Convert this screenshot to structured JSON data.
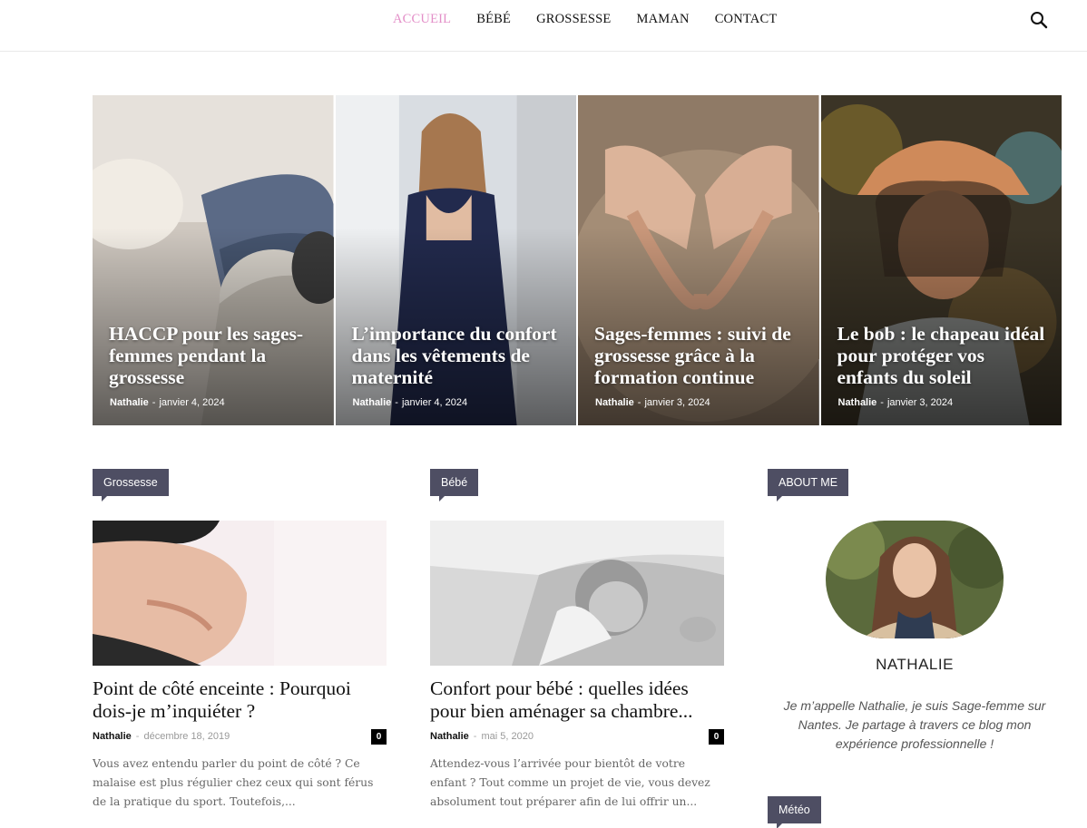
{
  "nav": {
    "items": [
      {
        "label": "ACCUEIL",
        "active": true
      },
      {
        "label": "BÉBÉ",
        "active": false
      },
      {
        "label": "GROSSESSE",
        "active": false
      },
      {
        "label": "MAMAN",
        "active": false
      },
      {
        "label": "CONTACT",
        "active": false
      }
    ],
    "search_icon": "search-icon",
    "active_color": "#e38fc8"
  },
  "featured": [
    {
      "title": "HACCP pour les sages-femmes pendant la grossesse",
      "author": "Nathalie",
      "date": "janvier 4, 2024"
    },
    {
      "title": "L’importance du confort dans les vêtements de maternité",
      "author": "Nathalie",
      "date": "janvier 4, 2024"
    },
    {
      "title": "Sages-femmes : suivi de grossesse grâce à la formation continue",
      "author": "Nathalie",
      "date": "janvier 3, 2024"
    },
    {
      "title": "Le bob : le chapeau idéal pour protéger vos enfants du soleil",
      "author": "Nathalie",
      "date": "janvier 3, 2024"
    }
  ],
  "columns": [
    {
      "category": "Grossesse",
      "title": "Point de côté enceinte : Pourquoi dois-je m’inquiéter ?",
      "author": "Nathalie",
      "separator": "-",
      "date": "décembre 18, 2019",
      "comments": "0",
      "excerpt": "Vous avez entendu parler du point de côté ? Ce malaise est plus régulier chez ceux qui sont férus de la pratique du sport. Toutefois,..."
    },
    {
      "category": "Bébé",
      "title": "Confort pour bébé : quelles idées pour bien aménager sa chambre...",
      "author": "Nathalie",
      "separator": "-",
      "date": "mai 5, 2020",
      "comments": "0",
      "excerpt": "Attendez-vous l’arrivée pour bientôt de votre enfant ? Tout comme un projet de vie, vous devez absolument tout préparer afin de lui offrir un..."
    }
  ],
  "sidebar": {
    "about_label": "ABOUT ME",
    "name": "NATHALIE",
    "bio": "Je m’appelle Nathalie, je suis Sage-femme sur Nantes. Je partage à travers ce blog mon expérience professionnelle !",
    "weather_label": "Météo"
  },
  "colors": {
    "tag_bg": "#4e4e63",
    "accent_pink": "#e38fc8"
  }
}
